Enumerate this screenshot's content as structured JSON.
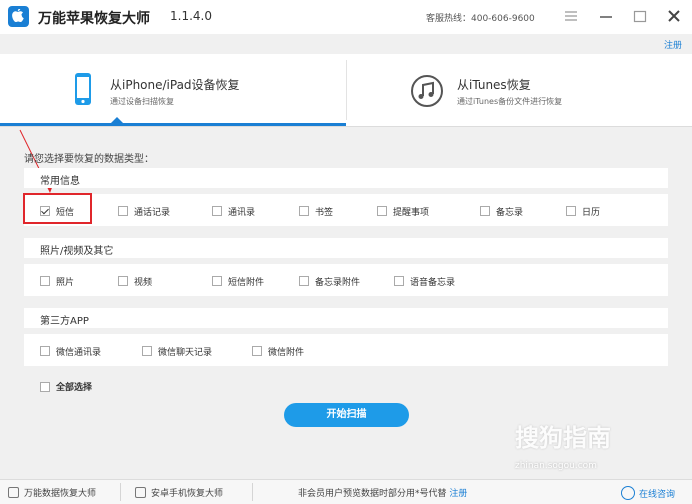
{
  "app": {
    "title": "万能苹果恢复大师",
    "version": "1.1.4.0",
    "hotline": "客服热线：400-606-9600",
    "register": "注册"
  },
  "modes": [
    {
      "title": "从iPhone/iPad设备恢复",
      "subtitle": "通过设备扫描恢复"
    },
    {
      "title": "从iTunes恢复",
      "subtitle": "通过iTunes备份文件进行恢复"
    }
  ],
  "prompt": "请您选择要恢复的数据类型：",
  "sections": [
    {
      "title": "常用信息",
      "options": [
        "短信",
        "通话记录",
        "通讯录",
        "书签",
        "提醒事项",
        "备忘录",
        "日历"
      ]
    },
    {
      "title": "照片/视频及其它",
      "options": [
        "照片",
        "视频",
        "短信附件",
        "备忘录附件",
        "语音备忘录"
      ]
    },
    {
      "title": "第三方APP",
      "options": [
        "微信通讯录",
        "微信聊天记录",
        "微信附件"
      ]
    }
  ],
  "checked": {
    "sms": true
  },
  "select_all": "全部选择",
  "scan_button": "开始扫描",
  "footer": {
    "item1": "万能数据恢复大师",
    "item2": "安卓手机恢复大师",
    "notice": "非会员用户预览数据时部分用*号代替",
    "register": "注册",
    "consult": "在线咨询"
  },
  "watermark": {
    "brand": "搜狗指南",
    "url": "zhinan.sogou.com"
  },
  "colors": {
    "accent": "#1a7fd4",
    "button": "#1e9be8",
    "highlight": "#e0262b"
  }
}
